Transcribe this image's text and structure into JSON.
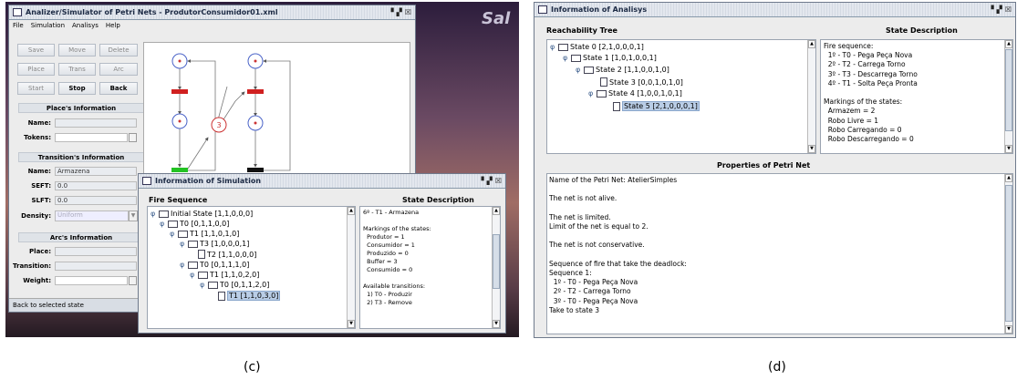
{
  "panel_c": {
    "caption": "(c)",
    "main_window": {
      "title": "Analizer/Simulator of Petri Nets - ProdutorConsumidor01.xml",
      "menu": [
        "File",
        "Simulation",
        "Analisys",
        "Help"
      ],
      "buttons": {
        "save": "Save",
        "move": "Move",
        "delete": "Delete",
        "place": "Place",
        "trans": "Trans",
        "arc": "Arc",
        "start": "Start",
        "stop": "Stop",
        "back": "Back"
      },
      "place_info": {
        "header": "Place's Information",
        "name_label": "Name:",
        "tokens_label": "Tokens:"
      },
      "transition_info": {
        "header": "Transition's Information",
        "name_label": "Name:",
        "name_value": "Armazena",
        "seft_label": "SEFT:",
        "seft_value": "0.0",
        "slft_label": "SLFT:",
        "slft_value": "0.0",
        "density_label": "Density:",
        "density_value": "Uniform"
      },
      "arc_info": {
        "header": "Arc's Information",
        "place_label": "Place:",
        "transition_label": "Transition:",
        "weight_label": "Weight:"
      },
      "status": "Back to selected state",
      "background_text": "Sal",
      "net_token_label": "3"
    },
    "simulation_window": {
      "title": "Information of Simulation",
      "fire_sequence_header": "Fire Sequence",
      "state_description_header": "State Description",
      "tree": [
        "Initial State [1,1,0,0,0]",
        "T0 [0,1,1,0,0]",
        "T1 [1,1,0,1,0]",
        "T3 [1,0,0,0,1]",
        "T2 [1,1,0,0,0]",
        "T0 [0,1,1,1,0]",
        "T1 [1,1,0,2,0]",
        "T0 [0,1,1,2,0]",
        "T1 [1,1,0,3,0]"
      ],
      "description": "6º - T1 - Armazena\n\nMarkings of the states:\n  Produtor = 1\n  Consumidor = 1\n  Produzido = 0\n  Buffer = 3\n  Consumido = 0\n\nAvailable transitions:\n  1) T0 - Produzir\n  2) T3 - Remove"
    }
  },
  "panel_d": {
    "caption": "(d)",
    "window": {
      "title": "Information of Analisys",
      "reachability_header": "Reachability Tree",
      "state_description_header": "State Description",
      "properties_header": "Properties of Petri Net",
      "tree": [
        "State 0 [2,1,0,0,0,1]",
        "State 1 [1,0,1,0,0,1]",
        "State 2 [1,1,0,0,1,0]",
        "State 3 [0,0,1,0,1,0]",
        "State 4 [1,0,0,1,0,1]",
        "State 5 [2,1,0,0,0,1]"
      ],
      "description": "Fire sequence:\n  1º - T0 - Pega Peça Nova\n  2º - T2 - Carrega Torno\n  3º - T3 - Descarrega Torno\n  4º - T1 - Solta Peça Pronta\n\nMarkings of the states:\n  Armazem = 2\n  Robo Livre = 1\n  Robo Carregando = 0\n  Robo Descarregando = 0",
      "properties": "Name of the Petri Net: AtelierSimples\n\nThe net is not alive.\n\nThe net is limited.\nLimit of the net is equal to 2.\n\nThe net is not conservative.\n\nSequence of fire that take the deadlock:\nSequence 1:\n  1º - T0 - Pega Peça Nova\n  2º - T2 - Carrega Torno\n  3º - T0 - Pega Peça Nova\nTake to state 3"
    }
  }
}
